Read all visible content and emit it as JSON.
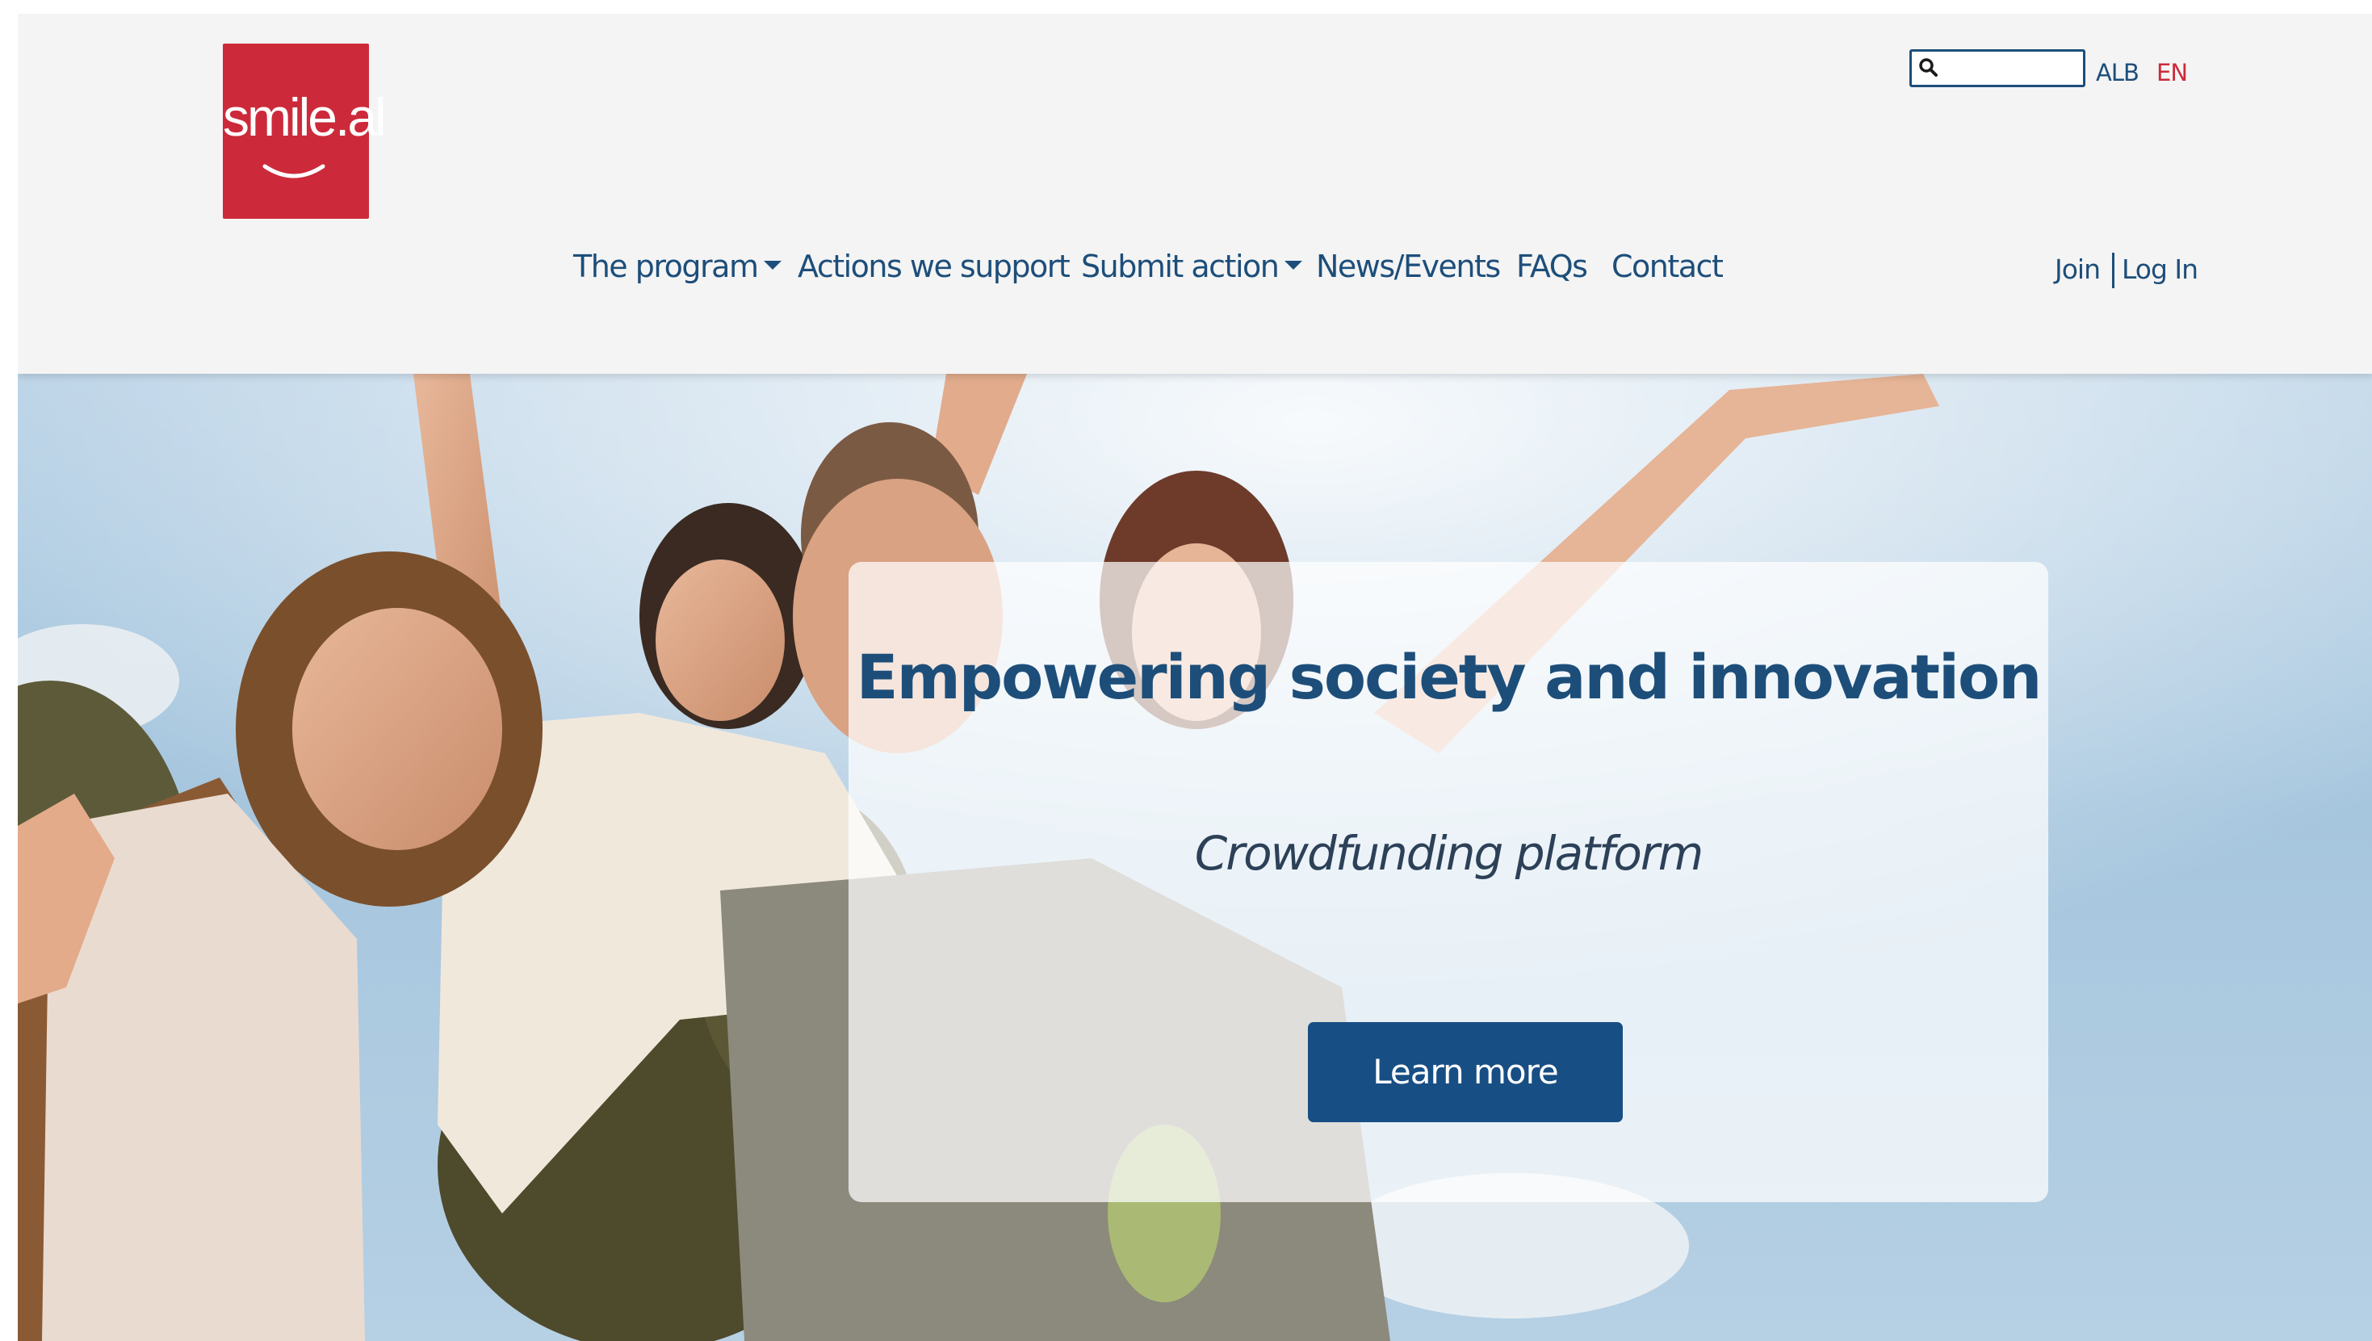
{
  "brand": {
    "logo_text": "smile.al",
    "logo_color": "#cc2a3a"
  },
  "search": {
    "placeholder": "",
    "value": "",
    "icon": "search-icon"
  },
  "languages": {
    "items": [
      "ALB",
      "EN"
    ],
    "active": "EN"
  },
  "nav": {
    "items": [
      {
        "label": "The program",
        "has_dropdown": true
      },
      {
        "label": "Actions we support",
        "has_dropdown": false
      },
      {
        "label": "Submit action",
        "has_dropdown": true
      },
      {
        "label": "News/Events",
        "has_dropdown": false
      },
      {
        "label": "FAQs",
        "has_dropdown": false
      },
      {
        "label": "Contact",
        "has_dropdown": false
      }
    ]
  },
  "auth": {
    "join_label": "Join",
    "login_label": "Log In"
  },
  "hero": {
    "title": "Empowering society and innovation",
    "subtitle": "Crowdfunding platform",
    "cta_label": "Learn more"
  },
  "colors": {
    "primary": "#1d4e7a",
    "button": "#174e84",
    "accent": "#cc2a3a",
    "header_bg": "#f4f4f4"
  }
}
